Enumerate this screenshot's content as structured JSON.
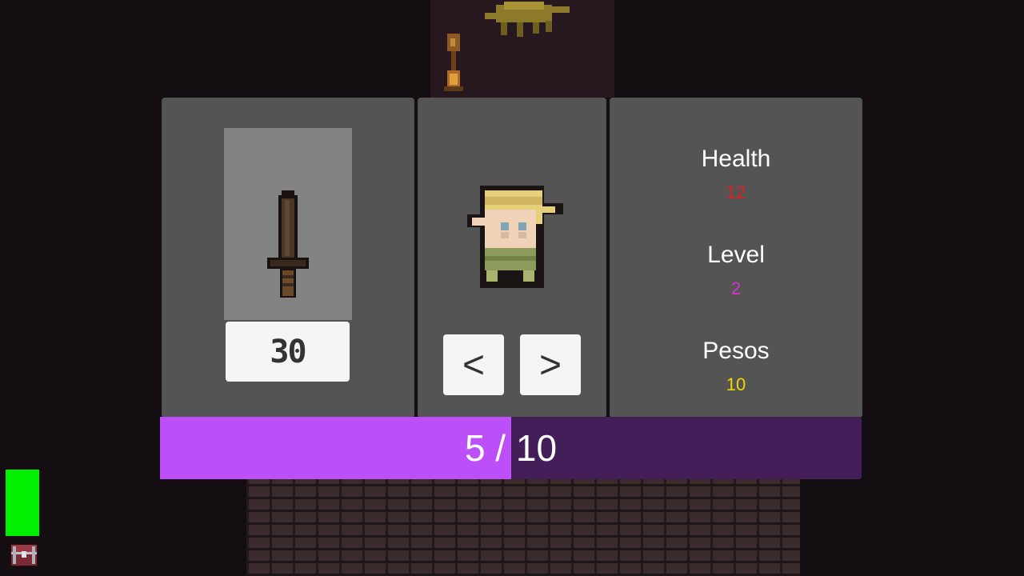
{
  "weapon_panel": {
    "upgrade_cost": "30",
    "weapon_icon": "sword-icon"
  },
  "character_panel": {
    "prev_label": "<",
    "next_label": ">",
    "character_icon": "blonde-hero-icon"
  },
  "stats": {
    "health_label": "Health",
    "health_value": "12",
    "level_label": "Level",
    "level_value": "2",
    "pesos_label": "Pesos",
    "pesos_value": "10"
  },
  "xp": {
    "current": "5",
    "separator": " / ",
    "max": "10",
    "fraction": 0.5
  },
  "hud": {
    "health_fill": 1.0,
    "menu_icon": "chest-icon"
  },
  "colors": {
    "panel": "#545454",
    "health": "#e02020",
    "level": "#d633d6",
    "pesos": "#f2d400",
    "xp_fill": "#bd4ff8",
    "xp_bg": "#441e58",
    "hp_bar": "#00f000"
  }
}
